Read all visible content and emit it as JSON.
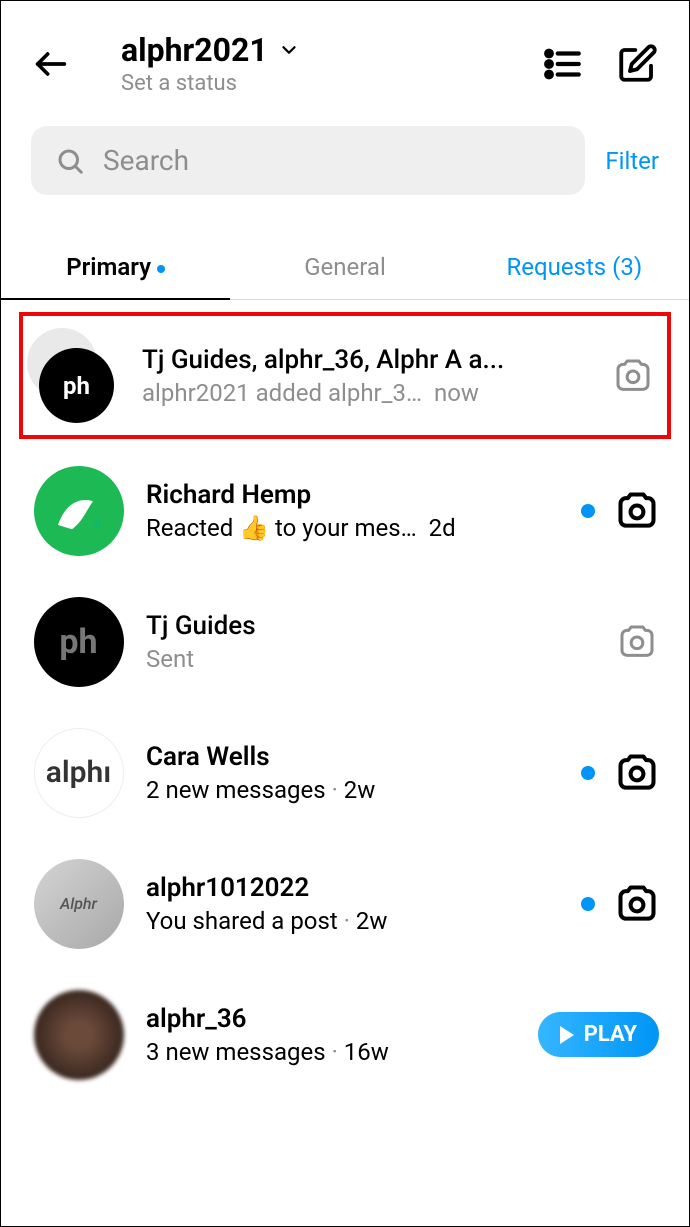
{
  "header": {
    "username": "alphr2021",
    "status": "Set a status"
  },
  "search": {
    "placeholder": "Search",
    "filter_label": "Filter"
  },
  "tabs": {
    "primary": "Primary",
    "general": "General",
    "requests": "Requests (3)",
    "requests_count": 3
  },
  "chats": [
    {
      "name": "Tj Guides, alphr_36, Alphr A a...",
      "preview": "alphr2021 added alphr_3…",
      "time": "now",
      "unread": false,
      "highlighted": true,
      "action": "camera",
      "avatar_type": "group"
    },
    {
      "name": "Richard Hemp",
      "preview": "Reacted 👍 to your mes…",
      "time": "2d",
      "unread": true,
      "action": "camera-bold",
      "avatar_type": "green"
    },
    {
      "name": "Tj Guides",
      "preview": "Sent",
      "time": "",
      "unread": false,
      "action": "camera",
      "avatar_type": "black"
    },
    {
      "name": "Cara Wells",
      "preview": "2 new messages",
      "time": "2w",
      "unread": true,
      "action": "camera-bold",
      "avatar_type": "white-text",
      "avatar_text": "alphı"
    },
    {
      "name": "alphr1012022",
      "preview": "You shared a post",
      "time": "2w",
      "unread": true,
      "action": "camera-bold",
      "avatar_type": "grey",
      "avatar_text": "Alphr"
    },
    {
      "name": "alphr_36",
      "preview": "3 new messages",
      "time": "16w",
      "unread": true,
      "action": "play",
      "avatar_type": "blur"
    }
  ],
  "play_label": "PLAY"
}
